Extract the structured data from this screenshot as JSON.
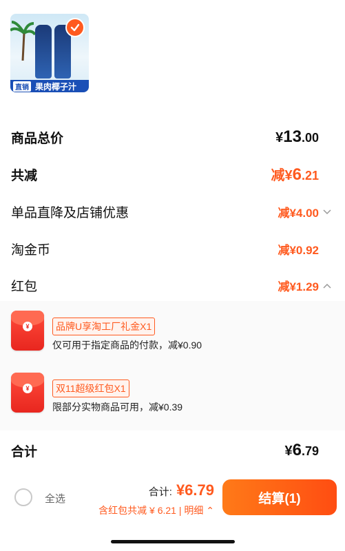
{
  "product": {
    "check_icon": "checkmark-icon",
    "banner_tag": "直销",
    "banner_name": "果肉椰子汁"
  },
  "rows": {
    "total": {
      "label": "商品总价",
      "currency": "¥",
      "int": "13",
      "dec": ".00"
    },
    "saved": {
      "label": "共减",
      "prefix": "减¥",
      "int": "6",
      "dec": ".21"
    },
    "direct": {
      "label": "单品直降及店铺优惠",
      "value": "减¥4.00",
      "icon": "chevron-down-icon"
    },
    "coin": {
      "label": "淘金币",
      "value": "减¥0.92"
    },
    "redpacket": {
      "label": "红包",
      "value": "减¥1.29",
      "icon": "chevron-up-icon"
    }
  },
  "red_packets": [
    {
      "tag": "品牌U享淘工厂礼金X1",
      "desc": "仅可用于指定商品的付款，减¥0.90",
      "icon": "red-envelope-icon",
      "coin": "¥"
    },
    {
      "tag": "双11超级红包X1",
      "desc": "限部分实物商品可用，减¥0.39",
      "icon": "red-envelope-icon",
      "coin": "¥"
    }
  ],
  "subtotal": {
    "label": "合计",
    "currency": "¥",
    "int": "6",
    "dec": ".79"
  },
  "bottom_bar": {
    "select_all": "全选",
    "total_label": "合计:",
    "total_value": "¥6.79",
    "discount_note": "含红包共减 ¥ 6.21 | 明细 ⌃",
    "checkout": "结算(1)"
  },
  "colors": {
    "accent": "#ff5a1f",
    "checkout_start": "#ff7a18",
    "checkout_end": "#ff4d12"
  }
}
